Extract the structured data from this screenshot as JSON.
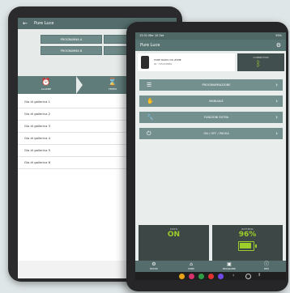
{
  "back": {
    "app_title": "Pure Luce",
    "buttons": [
      "PROGRAMMA A",
      "",
      "PROGRAMMA B",
      ""
    ],
    "steps": [
      "ALARME",
      "TEMPO"
    ],
    "list": [
      "Gio di gallerica 1",
      "Gio di gallerica 2",
      "Gio di gallerica 3",
      "Gio di gallerica 4",
      "Gio di gallerica 5",
      "Gio di gallerica 6"
    ]
  },
  "front": {
    "status_time": "13:31  Mer 10 Set",
    "status_icons": "95%",
    "app_title": "Pure Luce",
    "device_name": "PURE RADIO DO ZONE",
    "device_sub": "ID: 745430665",
    "connection_label": "CONNECTION",
    "menu": [
      {
        "label": "PROGRAMMAZIONE",
        "icon": "list-icon"
      },
      {
        "label": "MANUALE",
        "icon": "hand-icon"
      },
      {
        "label": "FUNZIONI EXTRA",
        "icon": "wrench-icon"
      },
      {
        "label": "ON / OFF / PAUSA",
        "icon": "power-icon"
      }
    ],
    "status_header": "STATO",
    "status_value": "ON",
    "battery_header": "BATTERIA",
    "battery_value": "96%",
    "battery_level": 96,
    "nav": [
      "DEVICE",
      "HOME",
      "PROGRAMMI",
      "INFO"
    ],
    "colors": {
      "accent_green": "#9ccd2b",
      "bar": "#546d6c",
      "button": "#73908e"
    }
  }
}
